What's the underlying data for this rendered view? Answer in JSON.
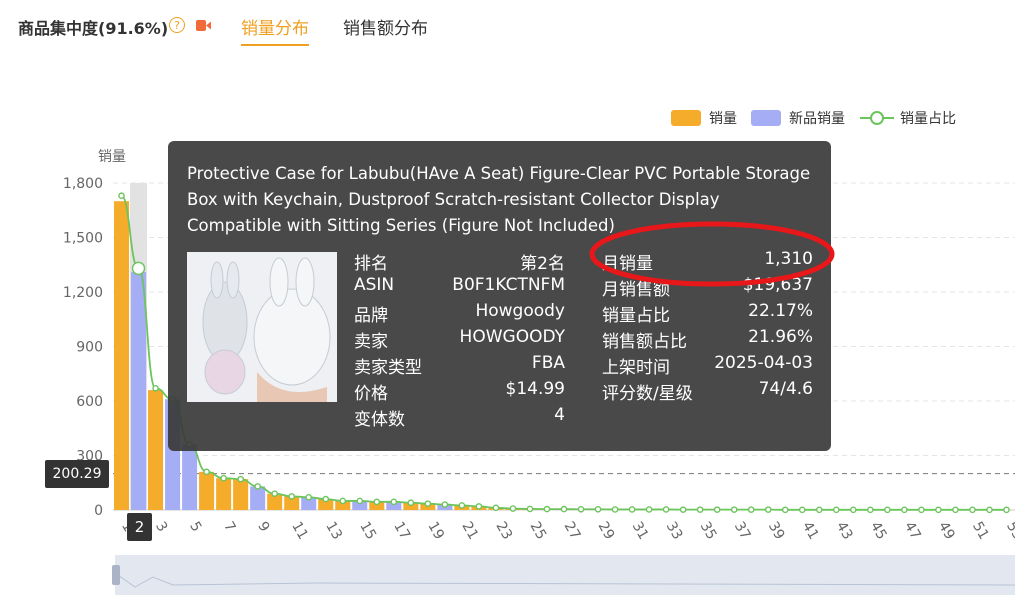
{
  "header": {
    "title": "商品集中度(91.6%)",
    "help_icon": "question-circle-icon",
    "video_icon": "video-camera-icon",
    "tabs": [
      {
        "label": "销量分布",
        "active": true
      },
      {
        "label": "销售额分布",
        "active": false
      }
    ],
    "accent_color": "#f0a020"
  },
  "legend": {
    "items": [
      {
        "label": "销量",
        "color": "#f5ac2b"
      },
      {
        "label": "新品销量",
        "color": "#a5aef5"
      },
      {
        "label": "销量占比",
        "color": "#6cc45c"
      }
    ]
  },
  "chart_data": {
    "type": "bar",
    "ylabel": "销量",
    "ylim": [
      0,
      1800
    ],
    "yticks": [
      "0",
      "300",
      "600",
      "900",
      "1,200",
      "1,500",
      "1,800"
    ],
    "x": [
      1,
      2,
      3,
      4,
      5,
      6,
      7,
      8,
      9,
      10,
      11,
      12,
      13,
      14,
      15,
      16,
      17,
      18,
      19,
      20,
      21,
      22,
      23,
      24,
      25,
      26,
      27,
      28,
      29,
      30,
      31,
      32,
      33,
      34,
      35,
      36,
      37,
      38,
      39,
      40,
      41,
      42,
      43,
      44,
      45,
      46,
      47,
      48,
      49,
      50,
      51,
      52,
      53
    ],
    "xtick_labels": [
      "1",
      "3",
      "5",
      "7",
      "9",
      "11",
      "13",
      "15",
      "17",
      "19",
      "21",
      "23",
      "25",
      "27",
      "29",
      "31",
      "33",
      "35",
      "37",
      "39",
      "41",
      "43",
      "45",
      "47",
      "49",
      "51",
      "53"
    ],
    "series": [
      {
        "name": "销量",
        "color": "#f5ac2b",
        "values": [
          1700,
          0,
          660,
          0,
          0,
          210,
          175,
          170,
          0,
          90,
          75,
          0,
          60,
          50,
          0,
          45,
          0,
          40,
          35,
          0,
          25,
          20,
          12,
          8,
          6,
          5,
          5,
          4,
          4,
          3,
          3,
          3,
          3,
          2,
          2,
          2,
          2,
          2,
          2,
          1,
          1,
          1,
          1,
          1,
          1,
          1,
          1,
          1,
          1,
          1,
          1,
          1,
          1
        ]
      },
      {
        "name": "新品销量",
        "color": "#a5aef5",
        "values": [
          0,
          1310,
          0,
          610,
          360,
          0,
          0,
          0,
          130,
          0,
          0,
          70,
          0,
          0,
          50,
          0,
          45,
          0,
          0,
          30,
          0,
          0,
          0,
          0,
          0,
          0,
          0,
          0,
          0,
          0,
          0,
          0,
          0,
          0,
          0,
          0,
          0,
          0,
          0,
          0,
          0,
          0,
          0,
          0,
          0,
          0,
          0,
          0,
          0,
          0,
          0,
          0,
          0
        ]
      },
      {
        "name": "销量占比",
        "color": "#6cc45c",
        "type": "line",
        "values": [
          1730,
          1330,
          670,
          610,
          360,
          210,
          175,
          170,
          130,
          90,
          75,
          70,
          60,
          50,
          50,
          45,
          45,
          40,
          35,
          30,
          25,
          20,
          12,
          8,
          6,
          5,
          5,
          4,
          4,
          3,
          3,
          3,
          3,
          2,
          2,
          2,
          2,
          2,
          2,
          1,
          1,
          1,
          1,
          1,
          1,
          1,
          1,
          1,
          1,
          1,
          1,
          1,
          1
        ]
      }
    ],
    "reference_line": {
      "value": 200.29,
      "label": "200.29"
    },
    "highlighted_x": {
      "index": 2,
      "label": "2"
    }
  },
  "tooltip": {
    "title": "Protective Case for Labubu(HAve A Seat) Figure-Clear PVC Portable Storage Box with Keychain, Dustproof Scratch-resistant Collector Display Compatible with Sitting Series (Figure Not Included)",
    "left": [
      {
        "k": "排名",
        "v": "第2名"
      },
      {
        "k": "ASIN",
        "v": "B0F1KCTNFM"
      },
      {
        "k": "品牌",
        "v": "Howgoody"
      },
      {
        "k": "卖家",
        "v": "HOWGOODY"
      },
      {
        "k": "卖家类型",
        "v": "FBA"
      },
      {
        "k": "价格",
        "v": "$14.99"
      },
      {
        "k": "变体数",
        "v": "4"
      }
    ],
    "right": [
      {
        "k": "月销量",
        "v": "1,310"
      },
      {
        "k": "月销售额",
        "v": "$19,637"
      },
      {
        "k": "销量占比",
        "v": "22.17%"
      },
      {
        "k": "销售额占比",
        "v": "21.96%"
      },
      {
        "k": "上架时间",
        "v": "2025-04-03"
      },
      {
        "k": "评分数/星级",
        "v": "74/4.6"
      }
    ]
  }
}
